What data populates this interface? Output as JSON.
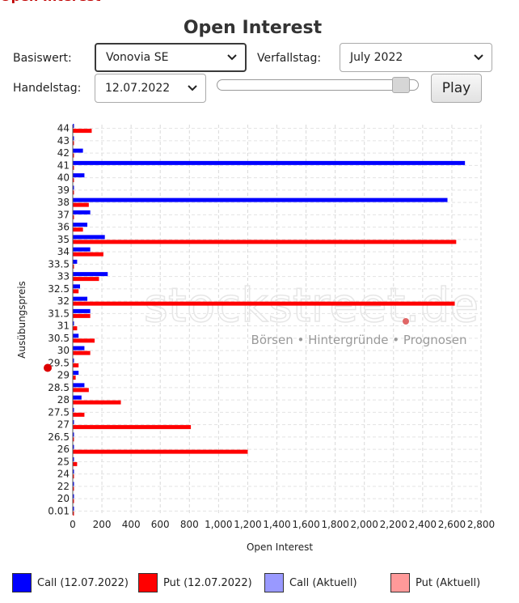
{
  "header": {
    "title": "Open Interest"
  },
  "controls": {
    "basiswert_label": "Basiswert:",
    "basiswert_value": "Vonovia SE",
    "verfallstag_label": "Verfallstag:",
    "verfallstag_value": "July 2022",
    "handelstag_label": "Handelstag:",
    "handelstag_value": "12.07.2022",
    "slider_position": 0.95,
    "play_label": "Play"
  },
  "watermark": {
    "brand": "stockstreet.de",
    "tagline": "Börsen • Hintergründe • Prognosen"
  },
  "colors": {
    "call": "#0000ff",
    "put": "#ff0000",
    "call_aktuell": "#9999ff",
    "put_aktuell": "#ff9999",
    "marker": "#dd0000"
  },
  "chart_data": {
    "type": "bar",
    "orientation": "horizontal",
    "xlabel": "Open Interest",
    "ylabel": "Ausübungspreis",
    "xlim": [
      0,
      2800
    ],
    "xticks": [
      0,
      200,
      400,
      600,
      800,
      1000,
      1200,
      1400,
      1600,
      1800,
      2000,
      2200,
      2400,
      2600,
      2800
    ],
    "xtick_labels": [
      "0",
      "200",
      "400",
      "600",
      "800",
      "1,000",
      "1,200",
      "1,400",
      "1,600",
      "1,800",
      "2,000",
      "2,200",
      "2,400",
      "2,600",
      "2,800"
    ],
    "grid": true,
    "legend_position": "bottom",
    "current_price_marker": 29.3,
    "categories": [
      "44",
      "43",
      "42",
      "41",
      "40",
      "39",
      "38",
      "37",
      "36",
      "35",
      "34",
      "33.5",
      "33",
      "32.5",
      "32",
      "31.5",
      "31",
      "30.5",
      "30",
      "29.5",
      "29",
      "28.5",
      "28",
      "27.5",
      "27",
      "26.5",
      "26",
      "25",
      "24",
      "22",
      "20",
      "0.01"
    ],
    "series": [
      {
        "name": "Call (12.07.2022)",
        "values": [
          0,
          0,
          70,
          2690,
          80,
          0,
          2570,
          120,
          100,
          220,
          120,
          30,
          240,
          50,
          100,
          120,
          0,
          40,
          80,
          0,
          40,
          80,
          60,
          0,
          0,
          0,
          0,
          0,
          0,
          0,
          0,
          0
        ]
      },
      {
        "name": "Put (12.07.2022)",
        "values": [
          130,
          0,
          0,
          0,
          0,
          0,
          110,
          0,
          70,
          2630,
          210,
          0,
          180,
          40,
          2620,
          120,
          30,
          150,
          120,
          40,
          20,
          110,
          330,
          80,
          810,
          0,
          1200,
          30,
          0,
          0,
          0,
          0
        ]
      }
    ],
    "legend": [
      "Call (12.07.2022)",
      "Put (12.07.2022)",
      "Call (Aktuell)",
      "Put (Aktuell)"
    ]
  }
}
